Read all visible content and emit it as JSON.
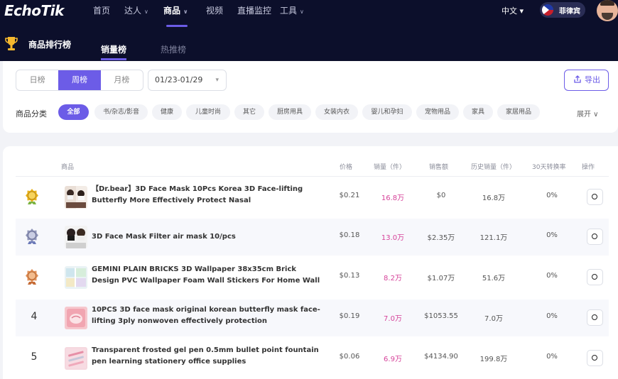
{
  "nav": {
    "logo": "EchoTik",
    "items": [
      {
        "label": "首页"
      },
      {
        "label": "达人",
        "caret": "∨"
      },
      {
        "label": "商品",
        "caret": "∨"
      },
      {
        "label": "视频"
      },
      {
        "label": "直播监控"
      },
      {
        "label": "工具",
        "caret": "∨"
      }
    ],
    "language": "中文 ▾",
    "country": "菲律宾"
  },
  "section": {
    "title": "商品排行榜",
    "tabs": [
      {
        "label": "销量榜"
      },
      {
        "label": "热推榜"
      }
    ]
  },
  "filters": {
    "periods": [
      {
        "label": "日榜"
      },
      {
        "label": "周榜"
      },
      {
        "label": "月榜"
      }
    ],
    "date_range": "01/23-01/29",
    "export_label": "导出",
    "category_label": "商品分类",
    "categories": [
      "全部",
      "书/杂志/影音",
      "健康",
      "儿童时尚",
      "其它",
      "厨房用具",
      "女装内衣",
      "婴儿和孕妇",
      "宠物用品",
      "家具",
      "家居用品"
    ],
    "expand_label": "展开 ∨"
  },
  "table": {
    "headers": {
      "product": "商品",
      "price": "价格",
      "sales": "销量（件）",
      "revenue": "销售额",
      "total_sales": "历史销量（件）",
      "conversion": "30天转换率",
      "action": "操作"
    },
    "rows": [
      {
        "rank": "1",
        "name": "【Dr.bear】3D Face Mask 10Pcs Korea 3D Face-lifting Butterfly More Effectively Protect Nasal",
        "price": "$0.21",
        "sales": "16.8万",
        "revenue": "$0",
        "total_sales": "16.8万",
        "conversion": "0%"
      },
      {
        "rank": "2",
        "name": "3D Face Mask Filter air mask 10/pcs",
        "price": "$0.18",
        "sales": "13.0万",
        "revenue": "$2.35万",
        "total_sales": "121.1万",
        "conversion": "0%"
      },
      {
        "rank": "3",
        "name": "GEMINI PLAIN BRICKS 3D Wallpaper 38x35cm Brick Design PVC Wallpaper Foam Wall Stickers For Home Wall Decor Livi…",
        "price": "$0.13",
        "sales": "8.2万",
        "revenue": "$1.07万",
        "total_sales": "51.6万",
        "conversion": "0%"
      },
      {
        "rank": "4",
        "name": "10PCS 3D face mask original korean butterfly mask face-lifting 3ply nonwoven effectively protection",
        "price": "$0.19",
        "sales": "7.0万",
        "revenue": "$1053.55",
        "total_sales": "7.0万",
        "conversion": "0%"
      },
      {
        "rank": "5",
        "name": "Transparent frosted gel pen 0.5mm bullet point fountain pen learning stationery office supplies",
        "price": "$0.06",
        "sales": "6.9万",
        "revenue": "$4134.90",
        "total_sales": "199.8万",
        "conversion": "0%"
      }
    ]
  },
  "colors": {
    "accent": "#6c5ce7",
    "nav_bg": "#0c0f2b",
    "sales_pink": "#d6439a",
    "gold": "#e8b21c",
    "silver": "#8f95b8",
    "bronze": "#e0915a"
  }
}
